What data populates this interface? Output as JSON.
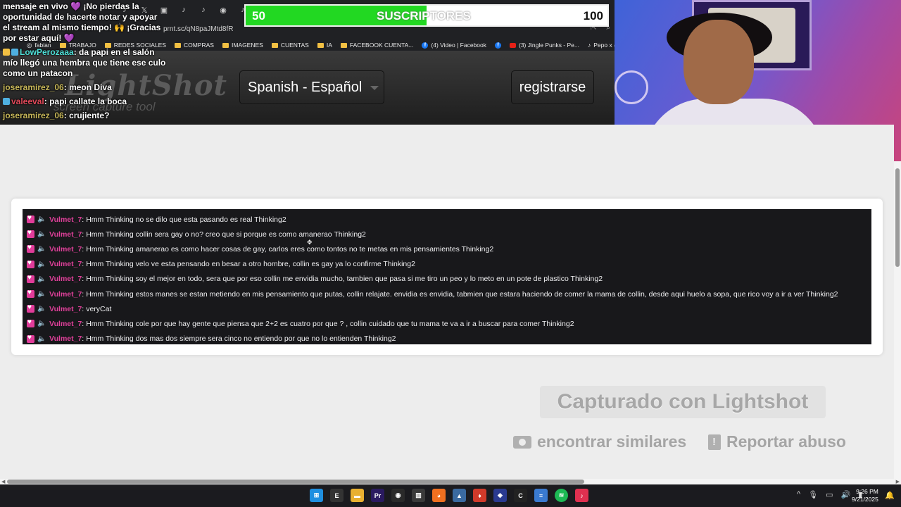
{
  "browser": {
    "url": "prnt.sc/qN8paJMtd8fR",
    "bookmarks": [
      {
        "label": "fabian",
        "icon": "profile-icon"
      },
      {
        "label": "TRABAJO",
        "icon": "folder-icon"
      },
      {
        "label": "REDES SOCIALES",
        "icon": "folder-icon"
      },
      {
        "label": "COMPRAS",
        "icon": "folder-icon"
      },
      {
        "label": "IMAGENES",
        "icon": "folder-icon"
      },
      {
        "label": "CUENTAS",
        "icon": "folder-icon"
      },
      {
        "label": "IA",
        "icon": "folder-icon"
      },
      {
        "label": "FACEBOOK CUENTA...",
        "icon": "folder-icon"
      },
      {
        "label": "(4) Video | Facebook",
        "icon": "facebook-icon"
      },
      {
        "label": "(3) Jingle Punks - Pe...",
        "icon": "youtube-icon"
      },
      {
        "label": "Pepo x @kazu.oficia...",
        "icon": "tiktok-icon"
      }
    ]
  },
  "lightshot": {
    "logo": "LightShot",
    "tagline": "screen capture tool",
    "language": "Spanish - Español",
    "register": "registrarse",
    "captured": "Capturado con Lightshot",
    "find_similar": "encontrar similares",
    "report_abuse": "Reportar abuso"
  },
  "stream_chat": [
    {
      "user": "",
      "text": "mensaje en vivo 💜 ¡No pierdas la oportunidad de hacerte notar y apoyar el stream al mismo tiempo! 🙌 ¡Gracias por estar aquí! 💜"
    },
    {
      "user": "LowPerozaaa",
      "sep": ": ",
      "text": "da papi en el salón mío llegó una hembra que tiene ese culo como un patacon"
    },
    {
      "user": "joseramirez_06",
      "sep": ": ",
      "text": "meon Diva"
    },
    {
      "user": "valeeval",
      "sep": ": ",
      "text": "papi callate la boca"
    },
    {
      "user": "joseramirez_06",
      "sep": ": ",
      "text": "crujiente?"
    }
  ],
  "subscribers": {
    "current": "50",
    "label": "SUSCRIPTORES",
    "goal": "100",
    "progress": 0.5,
    "fill_color": "#22d822"
  },
  "chat_log": {
    "username": "Vulmet_7",
    "colon": ":",
    "messages": [
      "Hmm Thinking no se dilo que esta pasando es real Thinking2",
      "Hmm Thinking collin sera gay o no? creo que si porque es como amanerao Thinking2",
      "Hmm Thinking amanerao es como hacer cosas de gay, carlos eres como tontos no te metas en mis pensamientes Thinking2",
      "Hmm Thinking velo ve esta pensando en besar a otro hombre, collin es gay ya lo confirme Thinking2",
      "Hmm Thinking soy el mejor en todo, sera que por eso collin me envidia mucho, tambien que pasa si me tiro un peo y lo meto en un pote de plastico Thinking2",
      "Hmm Thinking estos manes se estan metiendo en mis pensamiento que putas, collin relajate. envidia es envidia, tabmien que estara haciendo de comer la mama de collin, desde aqui huelo a sopa, que rico voy a ir a ver Thinking2",
      "veryCat",
      "Hmm Thinking cole por que hay gente que piensa que 2+2 es cuatro por que ? , collin cuidado que tu mama te va a ir a buscar para comer Thinking2",
      "Hmm Thinking dos mas dos siempre sera cinco no entiendo por que no lo entienden Thinking2"
    ],
    "username_color": "#e0409a"
  },
  "taskbar": {
    "time": "9:26 PM",
    "date": "9/21/2025"
  }
}
